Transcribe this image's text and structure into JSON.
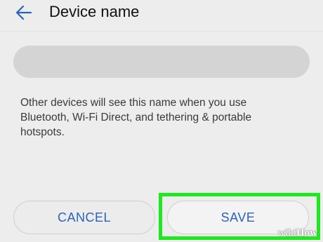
{
  "header": {
    "back_icon": "arrow-left-icon",
    "title": "Device name"
  },
  "name_field": {
    "value": "",
    "placeholder": ""
  },
  "help_text": "Other devices will see this name when you use Bluetooth, Wi-Fi Direct, and tethering & portable hotspots.",
  "buttons": {
    "cancel_label": "CANCEL",
    "save_label": "SAVE"
  },
  "highlight_color": "#1ee81e",
  "accent_color": "#2b63b8",
  "watermark": {
    "prefix": "wiki",
    "suffix": "How"
  }
}
